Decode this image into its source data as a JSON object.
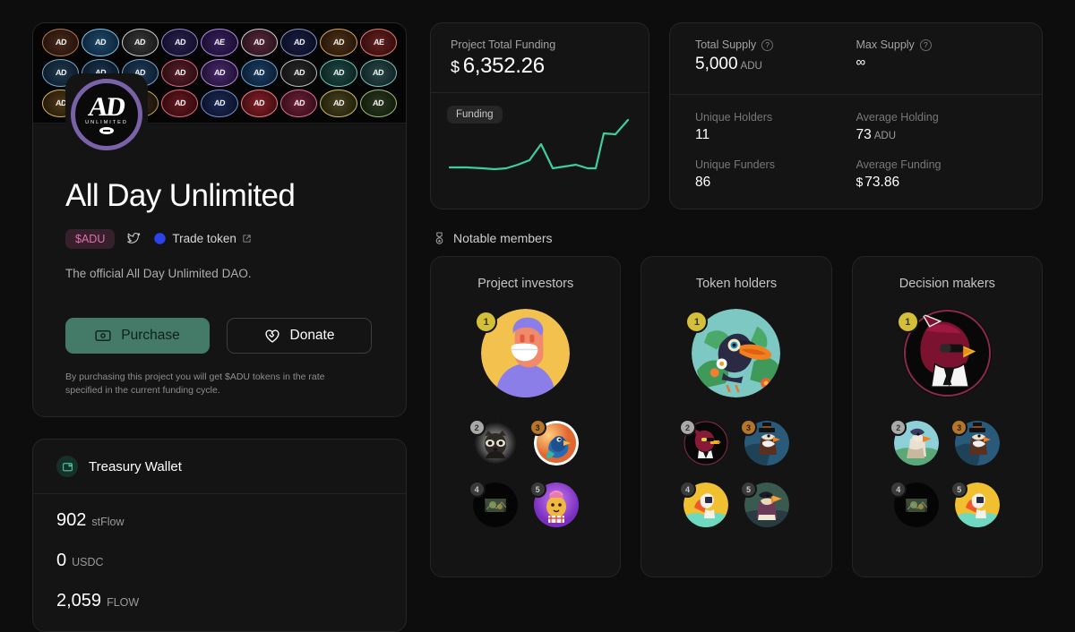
{
  "project": {
    "title": "All Day Unlimited",
    "token_badge": "$ADU",
    "trade_link": "Trade token",
    "description": "The official All Day Unlimited DAO.",
    "purchase_label": "Purchase",
    "donate_label": "Donate",
    "fineprint": "By purchasing this project you will get $ADU tokens in the rate specified in the current funding cycle.",
    "logo_text": "AD",
    "logo_sub": "UNLIMITED"
  },
  "treasury": {
    "title": "Treasury Wallet",
    "balances": [
      {
        "amount": "902",
        "symbol": "stFlow"
      },
      {
        "amount": "0",
        "symbol": "USDC"
      },
      {
        "amount": "2,059",
        "symbol": "FLOW"
      }
    ]
  },
  "funding": {
    "label": "Project Total Funding",
    "currency": "$",
    "amount": "6,352.26",
    "chip": "Funding"
  },
  "supply": {
    "total_supply_label": "Total Supply",
    "total_supply_value": "5,000",
    "total_supply_unit": "ADU",
    "max_supply_label": "Max Supply",
    "max_supply_value": "∞",
    "unique_holders_label": "Unique Holders",
    "unique_holders_value": "11",
    "average_holding_label": "Average Holding",
    "average_holding_value": "73",
    "average_holding_unit": "ADU",
    "unique_funders_label": "Unique Funders",
    "unique_funders_value": "86",
    "average_funding_label": "Average Funding",
    "average_funding_currency": "$",
    "average_funding_value": "73.86",
    "help_glyph": "?"
  },
  "notable_members": {
    "section_title": "Notable members",
    "cards": [
      {
        "title": "Project investors",
        "ranks": [
          "1",
          "2",
          "3",
          "4",
          "5"
        ]
      },
      {
        "title": "Token holders",
        "ranks": [
          "1",
          "2",
          "3",
          "4",
          "5"
        ]
      },
      {
        "title": "Decision makers",
        "ranks": [
          "1",
          "2",
          "3",
          "4",
          "5"
        ]
      }
    ]
  },
  "colors": {
    "page_bg": "#0d0d0d",
    "card_bg": "#141414",
    "accent_green": "#437a68",
    "chart_line": "#3fcf9a",
    "token_pink": "#e470ad",
    "logo_purple": "#7a62a8",
    "rank_gold": "#d4c038",
    "rank_silver": "#a9a9a9",
    "rank_bronze": "#b5762b"
  },
  "chart_data": {
    "type": "line",
    "title": "Funding",
    "xlabel": "",
    "ylabel": "",
    "x": [
      0,
      1,
      2,
      3,
      4,
      5,
      6,
      7,
      8,
      9,
      10,
      11,
      12,
      13,
      14,
      15,
      16
    ],
    "values": [
      20,
      20,
      19,
      18,
      17,
      18,
      22,
      26,
      42,
      18,
      20,
      22,
      19,
      19,
      62,
      60,
      80
    ],
    "ylim": [
      0,
      90
    ],
    "grid": false,
    "legend": "none",
    "line_color": "#3fcf9a"
  }
}
